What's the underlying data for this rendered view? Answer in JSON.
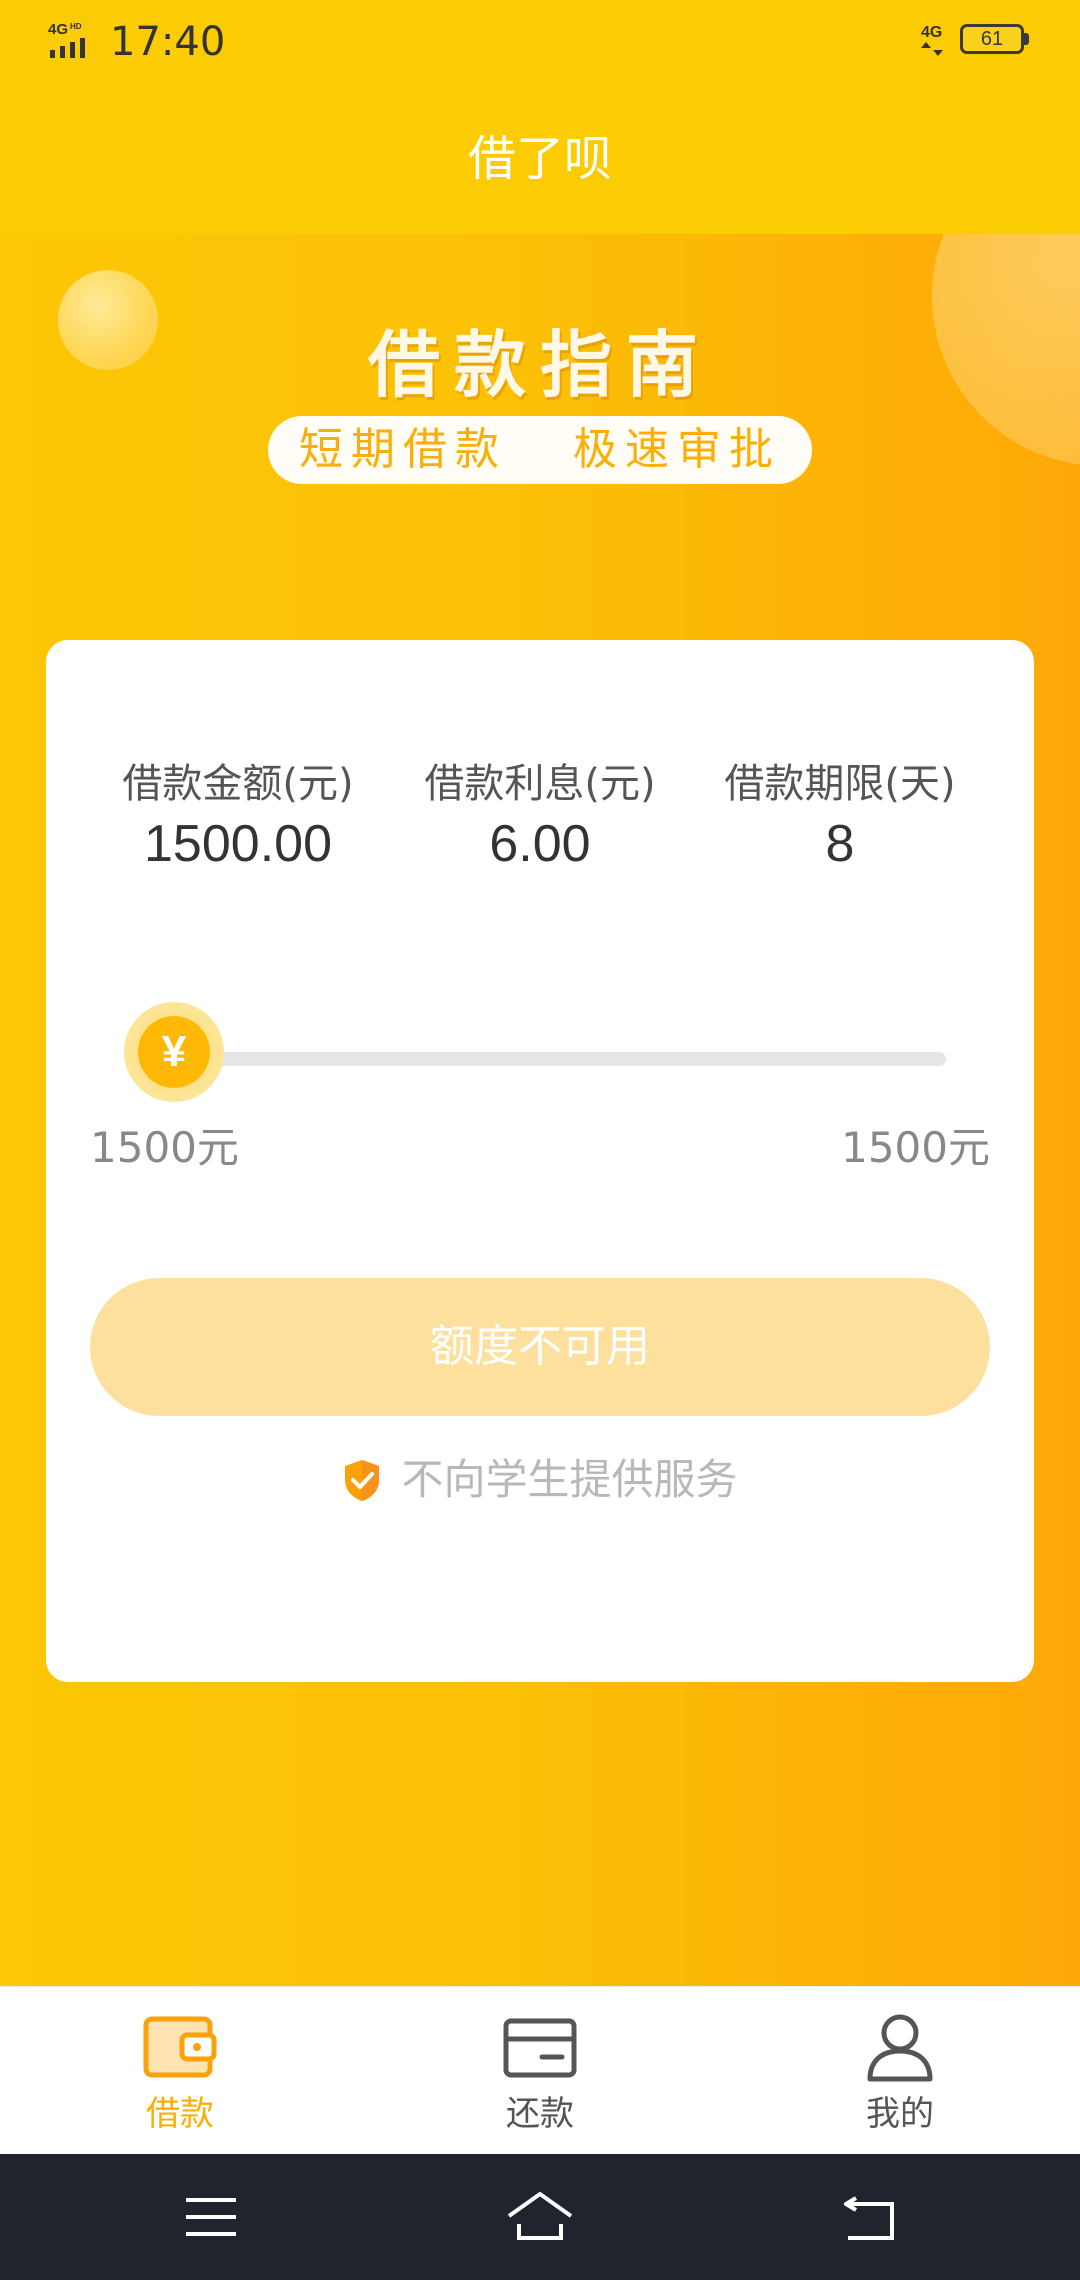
{
  "status_bar": {
    "time": "17:40",
    "network_left": "4G HD",
    "network_right": "4G",
    "battery": "61"
  },
  "app": {
    "title": "借了呗"
  },
  "hero": {
    "title": "借款指南",
    "subtitle": "短期借款   极速审批"
  },
  "loan_card": {
    "info": [
      {
        "label": "借款金额(元)",
        "value": "1500.00"
      },
      {
        "label": "借款利息(元)",
        "value": "6.00"
      },
      {
        "label": "借款期限(天)",
        "value": "8"
      }
    ],
    "slider": {
      "thumb_symbol": "¥",
      "min_label": "1500元",
      "max_label": "1500元",
      "position_fraction": 0
    },
    "button_label": "额度不可用",
    "notice": "不向学生提供服务"
  },
  "tabs": [
    {
      "label": "借款",
      "icon": "wallet-icon",
      "active": true
    },
    {
      "label": "还款",
      "icon": "card-icon",
      "active": false
    },
    {
      "label": "我的",
      "icon": "user-icon",
      "active": false
    }
  ],
  "nav": {
    "buttons": [
      "menu-icon",
      "home-icon",
      "back-icon"
    ]
  },
  "colors": {
    "primary_yellow": "#FBCB04",
    "accent_orange": "#FBAE08",
    "button_disabled": "#FEE09E",
    "nav_bar": "#20242D"
  }
}
